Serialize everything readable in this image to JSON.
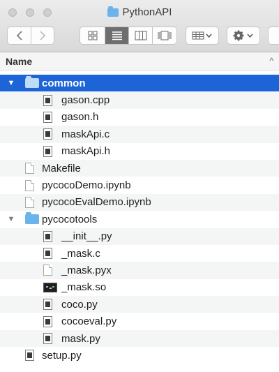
{
  "window": {
    "title": "PythonAPI"
  },
  "toolbar": {
    "back_icon": "chevron-left-icon",
    "forward_icon": "chevron-right-icon",
    "view_modes": [
      "icon-view-icon",
      "list-view-icon",
      "column-view-icon",
      "coverflow-view-icon"
    ],
    "selected_view": "list-view-icon",
    "arrange_icon": "arrange-grid-icon",
    "action_icon": "gear-icon"
  },
  "columns": {
    "name": "Name"
  },
  "files": [
    {
      "name": "common",
      "type": "folder",
      "expanded": true,
      "selected": true
    },
    {
      "name": "gason.cpp",
      "type": "exec",
      "indent": 1
    },
    {
      "name": "gason.h",
      "type": "exec",
      "indent": 1
    },
    {
      "name": "maskApi.c",
      "type": "exec",
      "indent": 1
    },
    {
      "name": "maskApi.h",
      "type": "exec",
      "indent": 1
    },
    {
      "name": "Makefile",
      "type": "doc"
    },
    {
      "name": "pycocoDemo.ipynb",
      "type": "doc"
    },
    {
      "name": "pycocoEvalDemo.ipynb",
      "type": "doc"
    },
    {
      "name": "pycocotools",
      "type": "folder",
      "expanded": true
    },
    {
      "name": "__init__.py",
      "type": "exec",
      "indent": 1
    },
    {
      "name": "_mask.c",
      "type": "exec",
      "indent": 1
    },
    {
      "name": "_mask.pyx",
      "type": "doc",
      "indent": 1
    },
    {
      "name": "_mask.so",
      "type": "bin",
      "indent": 1
    },
    {
      "name": "coco.py",
      "type": "exec",
      "indent": 1
    },
    {
      "name": "cocoeval.py",
      "type": "exec",
      "indent": 1
    },
    {
      "name": "mask.py",
      "type": "exec",
      "indent": 1
    },
    {
      "name": "setup.py",
      "type": "exec"
    }
  ]
}
